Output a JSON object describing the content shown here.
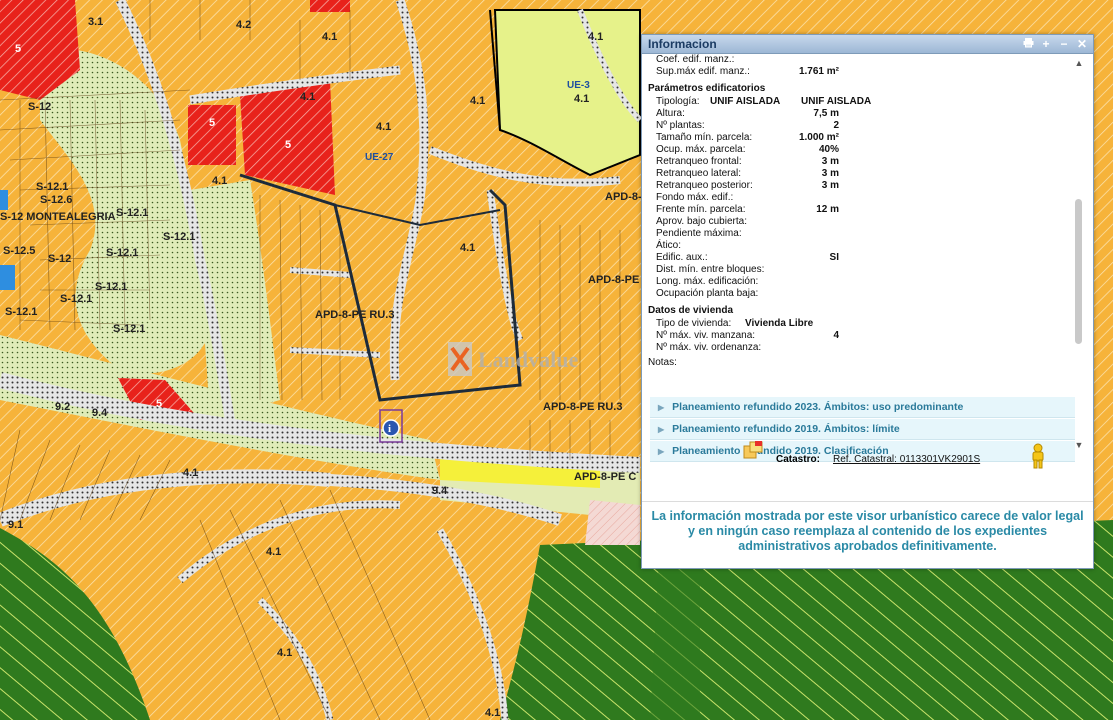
{
  "map": {
    "labels": {
      "l_3_1": "3.1",
      "l_4_2a": "4.2",
      "l_5a": "5",
      "l_4_1a": "4.1",
      "l_4_1b": "4.1",
      "l_4_1c": "4.1",
      "l_4_1d": "4.1",
      "l_4_1e": "4.1",
      "l_4_1f": "4.1",
      "l_4_1g": "4.1",
      "l_4_1h": "4.1",
      "l_4_1i": "4.1",
      "l_4_1j": "4.1",
      "l_4_1k": "4.1",
      "l_4_1l": "4.1",
      "l_5b": "5",
      "l_5c": "5",
      "l_5d": "5",
      "l_ue3": "UE-3",
      "l_ue27": "UE-27",
      "l_s12a": "S-12",
      "l_s12b": "S-12.1",
      "l_s12c": "S-12.6",
      "l_s12d": "S-12.1",
      "l_s12e": "S-12.1",
      "l_s12f": "S-12.1",
      "l_s12g": "S-12.1",
      "l_s12h": "S-12.1",
      "l_s12i": "S-12",
      "l_s12j": "S-12.1",
      "l_s12k": "S-12.1",
      "l_s12l": "S-12.5",
      "l_s12m": "S-12.1",
      "l_s12n": "S-12.1",
      "l_montealegria": "S-12 MONTEALEGRIA",
      "l_apd1": "APD-8-PE RU.3",
      "l_apd2": "APD-8-PE RU.3",
      "l_apd3": "APD-8-PE",
      "l_apd4": "APD-8-PE",
      "l_apd5": "APD-8-PE",
      "l_apd6": "APD-8-PE C",
      "l_apd7": "APD-8-PE",
      "l_9_2": "9.2",
      "l_9_4a": "9.4",
      "l_9_4b": "9.4",
      "l_9_1": "9.1",
      "l_4_2b": "4.2"
    },
    "watermark": "Landvalue",
    "colors": {
      "orange": "#f6b33a",
      "red": "#e8221b",
      "lime": "#e3f28a",
      "green": "#2f7a1e",
      "pale": "#dfeab6",
      "yellow": "#f5f03a"
    }
  },
  "panel": {
    "title": "Informacion",
    "buttons": {
      "print": "print-icon",
      "zoom": "+",
      "min": "−",
      "close": "✕"
    },
    "top_rows": [
      {
        "label": "Coef. edif. manz.:",
        "value": ""
      },
      {
        "label": "Sup.máx edif. manz.:",
        "value": "1.761 m²"
      }
    ],
    "sec_parametros": "Parámetros edificatorios",
    "tipologia_label": "Tipología:",
    "tipologia_vals": [
      "UNIF AISLADA",
      "UNIF AISLADA"
    ],
    "param_rows": [
      {
        "label": "Altura:",
        "value": "7,5 m"
      },
      {
        "label": "Nº plantas:",
        "value": "2"
      },
      {
        "label": "Tamaño mín. parcela:",
        "value": "1.000 m²"
      },
      {
        "label": "Ocup. máx. parcela:",
        "value": "40%"
      },
      {
        "label": "Retranqueo frontal:",
        "value": "3 m"
      },
      {
        "label": "Retranqueo lateral:",
        "value": "3 m"
      },
      {
        "label": "Retranqueo posterior:",
        "value": "3 m"
      },
      {
        "label": "Fondo máx. edif.:",
        "value": ""
      },
      {
        "label": "Frente mín. parcela:",
        "value": "12 m"
      },
      {
        "label": "Aprov. bajo cubierta:",
        "value": ""
      },
      {
        "label": "Pendiente máxima:",
        "value": ""
      },
      {
        "label": "Ático:",
        "value": ""
      },
      {
        "label": "Edific. aux.:",
        "value": "SI"
      },
      {
        "label": "Dist. mín. entre bloques:",
        "value": ""
      },
      {
        "label": "Long. máx. edificación:",
        "value": ""
      },
      {
        "label": "Ocupación planta baja:",
        "value": ""
      }
    ],
    "sec_vivienda": "Datos de vivienda",
    "tipo_viv_label": "Tipo de vivienda:",
    "tipo_viv_value": "Vivienda Libre",
    "viv_rows": [
      {
        "label": "Nº máx. viv. manzana:",
        "value": "4"
      },
      {
        "label": "Nº máx. viv. ordenanza:",
        "value": ""
      }
    ],
    "notas_label": "Notas:",
    "accordions": [
      "Planeamiento refundido 2023. Ámbitos: uso predominante",
      "Planeamiento refundido 2019. Ámbitos: límite",
      "Planeamiento refundido 2019. Clasificación"
    ],
    "catastro_label": "Catastro:",
    "catastro_ref": "Ref. Catastral: 0113301VK2901S",
    "disclaimer": "La información mostrada por este visor urbanístico carece de valor legal y en ningún caso reemplaza al contenido de los expedientes administrativos aprobados definitivamente."
  }
}
